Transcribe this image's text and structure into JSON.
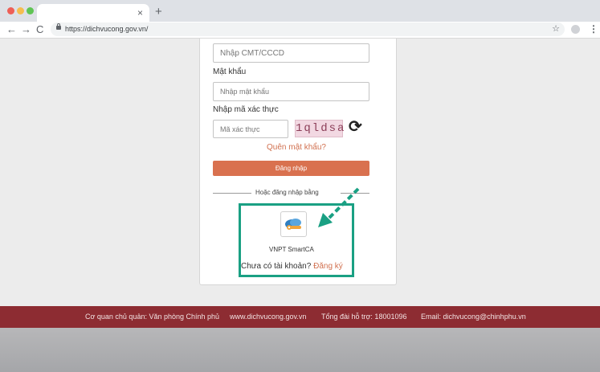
{
  "browser": {
    "tab_close": "×",
    "new_tab": "+",
    "url": "https://dichvucong.gov.vn/",
    "icons": {
      "back": "←",
      "forward": "→",
      "reload": "C",
      "star": "☆",
      "menu": "⋮"
    }
  },
  "login_form": {
    "id_placeholder": "Nhập CMT/CCCD",
    "password_label": "Mật khẩu",
    "password_placeholder": "Nhập mật khẩu",
    "captcha_label": "Nhập mã xác thực",
    "captcha_placeholder": "Mã xác thực",
    "captcha_text": "1qldsa",
    "refresh_icon": "⟳",
    "forgot_password": "Quên mật khẩu?",
    "login_button": "Đăng nhập",
    "or_login_with": "Hoặc đăng nhập bằng",
    "smartca_label": "VNPT SmartCA",
    "no_account_text": "Chưa có tài khoản?",
    "register_link": "Đăng ký"
  },
  "footer": {
    "agency": "Cơ quan chủ quản: Văn phòng Chính phủ",
    "website": "www.dichvucong.gov.vn",
    "hotline": "Tổng đài hỗ trợ: 18001096",
    "email": "Email: dichvucong@chinhphu.vn"
  },
  "colors": {
    "accent": "#d9714f",
    "highlight": "#1aa083",
    "footer": "#8d2c32"
  }
}
